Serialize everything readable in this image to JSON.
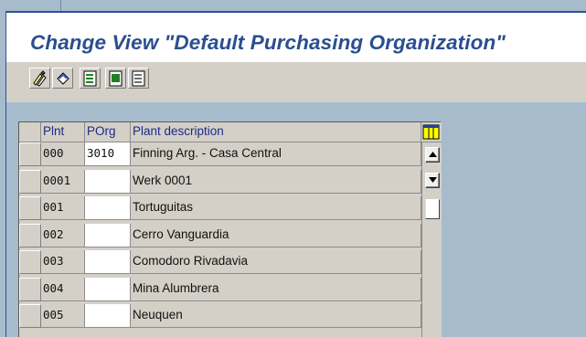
{
  "title": "Change View \"Default Purchasing Organization\"",
  "toolbar": {
    "buttons": [
      {
        "name": "display-change-icon"
      },
      {
        "name": "undo-icon"
      },
      {
        "name": "select-all-icon"
      },
      {
        "name": "select-block-icon"
      },
      {
        "name": "deselect-all-icon"
      }
    ]
  },
  "table": {
    "columns": {
      "plnt": "Plnt",
      "porg": "POrg",
      "desc": "Plant description"
    },
    "rows": [
      {
        "plnt": "000",
        "porg": "3010",
        "desc": "Finning Arg. - Casa Central"
      },
      {
        "plnt": "0001",
        "porg": "",
        "desc": "Werk 0001"
      },
      {
        "plnt": "001",
        "porg": "",
        "desc": "Tortuguitas"
      },
      {
        "plnt": "002",
        "porg": "",
        "desc": "Cerro Vanguardia"
      },
      {
        "plnt": "003",
        "porg": "",
        "desc": "Comodoro Rivadavia"
      },
      {
        "plnt": "004",
        "porg": "",
        "desc": "Mina Alumbrera"
      },
      {
        "plnt": "005",
        "porg": "",
        "desc": "Neuquen"
      }
    ]
  }
}
